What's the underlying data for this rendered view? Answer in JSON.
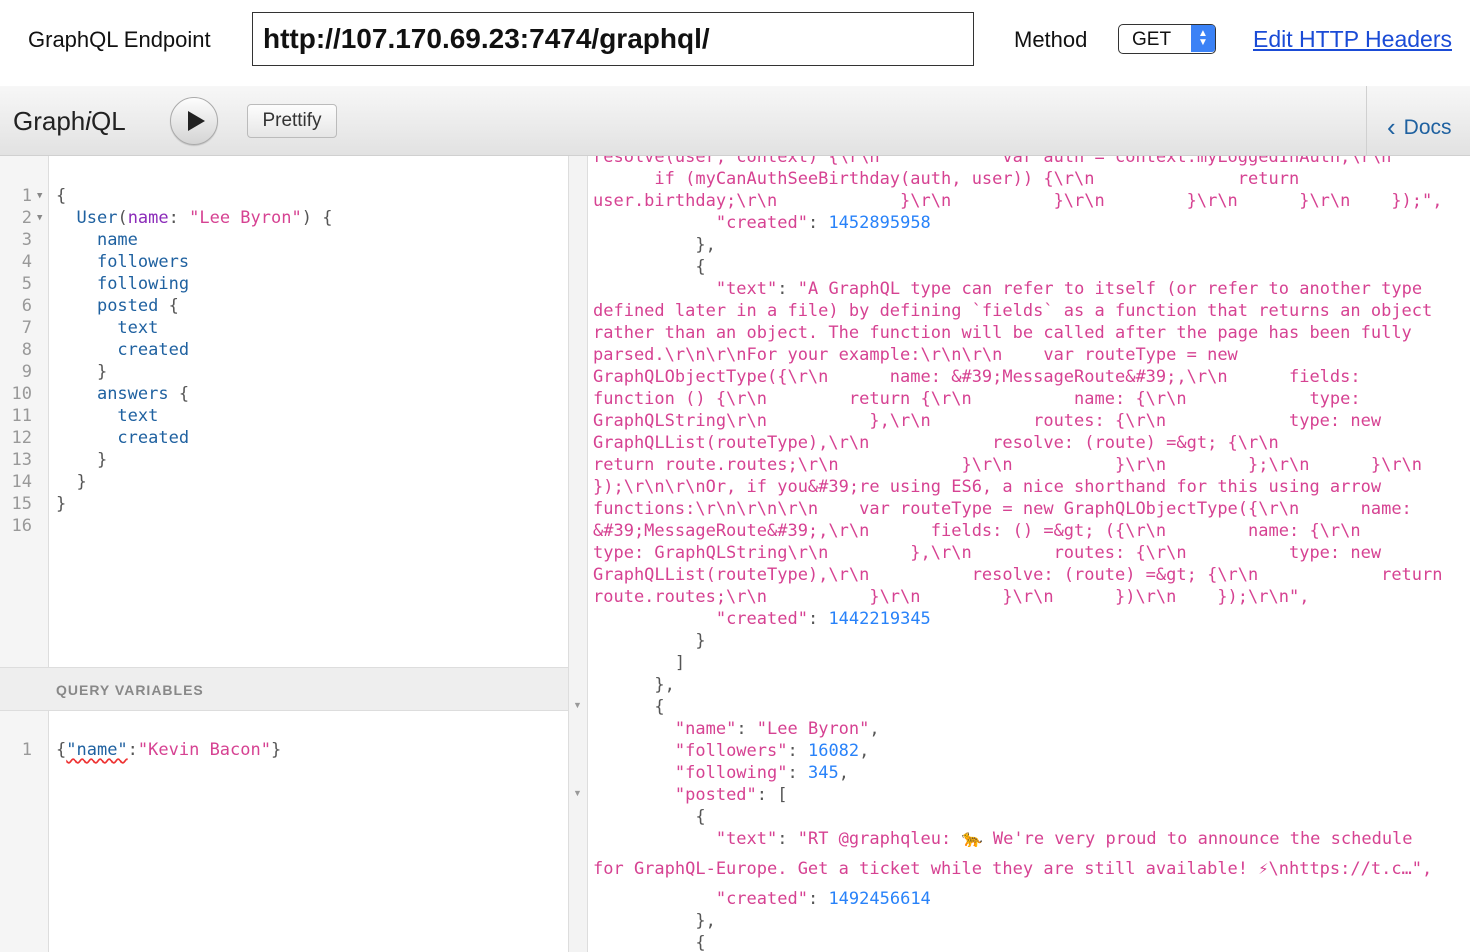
{
  "topbar": {
    "endpoint_label": "GraphQL Endpoint",
    "endpoint_url": "http://107.170.69.23:7474/graphql/",
    "method_label": "Method",
    "method_value": "GET",
    "headers_link": "Edit HTTP Headers"
  },
  "toolbar": {
    "logo_prefix": "Graph",
    "logo_italic": "i",
    "logo_suffix": "QL",
    "prettify_label": "Prettify",
    "docs_label": "Docs"
  },
  "query": {
    "line_numbers": [
      "1",
      "2",
      "3",
      "4",
      "5",
      "6",
      "7",
      "8",
      "9",
      "10",
      "11",
      "12",
      "13",
      "14",
      "15",
      "16"
    ],
    "l1": "{",
    "l2_field": "User",
    "l2_open": "(",
    "l2_arg": "name",
    "l2_colon": ": ",
    "l2_value": "\"Lee Byron\"",
    "l2_close": ") {",
    "l3": "name",
    "l4": "followers",
    "l5": "following",
    "l6_field": "posted",
    "l6_brace": " {",
    "l7": "text",
    "l8": "created",
    "l9": "}",
    "l10_field": "answers",
    "l10_brace": " {",
    "l11": "text",
    "l12": "created",
    "l13": "}",
    "l14": "}",
    "l15": "}"
  },
  "variables": {
    "title": "QUERY VARIABLES",
    "line_number": "1",
    "open": "{",
    "key": "\"name\"",
    "colon": ":",
    "value": "\"Kevin Bacon\"",
    "close": "}"
  },
  "result": {
    "lines": [
      {
        "type": "s",
        "text": "resolve(user, context) {\\r\\n            var auth = context.myLoggedInAuth;\\r\\n"
      },
      {
        "type": "s",
        "text": "      if (myCanAuthSeeBirthday(auth, user)) {\\r\\n              return"
      },
      {
        "type": "s",
        "text": "user.birthday;\\r\\n            }\\r\\n          }\\r\\n        }\\r\\n      }\\r\\n    });\","
      },
      {
        "type": "kv",
        "indent": "            ",
        "key": "\"created\"",
        "sep": ": ",
        "val": "1452895958",
        "valtype": "n",
        "tail": ""
      },
      {
        "type": "p",
        "text": "          },"
      },
      {
        "type": "p",
        "text": "          {"
      },
      {
        "type": "kv",
        "indent": "            ",
        "key": "\"text\"",
        "sep": ": ",
        "val": "\"A GraphQL type can refer to itself (or refer to another type",
        "valtype": "s",
        "tail": ""
      },
      {
        "type": "s",
        "text": "defined later in a file) by defining `fields` as a function that returns an object"
      },
      {
        "type": "s",
        "text": "rather than an object. The function will be called after the page has been fully"
      },
      {
        "type": "s",
        "text": "parsed.\\r\\n\\r\\nFor your example:\\r\\n\\r\\n    var routeType = new"
      },
      {
        "type": "s",
        "text": "GraphQLObjectType({\\r\\n      name: &#39;MessageRoute&#39;,\\r\\n      fields:"
      },
      {
        "type": "s",
        "text": "function () {\\r\\n        return {\\r\\n          name: {\\r\\n            type:"
      },
      {
        "type": "s",
        "text": "GraphQLString\\r\\n          },\\r\\n          routes: {\\r\\n            type: new"
      },
      {
        "type": "s",
        "text": "GraphQLList(routeType),\\r\\n            resolve: (route) =&gt; {\\r\\n"
      },
      {
        "type": "s",
        "text": "return route.routes;\\r\\n            }\\r\\n          }\\r\\n        };\\r\\n      }\\r\\n"
      },
      {
        "type": "s",
        "text": "});\\r\\n\\r\\nOr, if you&#39;re using ES6, a nice shorthand for this using arrow"
      },
      {
        "type": "s",
        "text": "functions:\\r\\n\\r\\n\\r\\n    var routeType = new GraphQLObjectType({\\r\\n      name:"
      },
      {
        "type": "s",
        "text": "&#39;MessageRoute&#39;,\\r\\n      fields: () =&gt; ({\\r\\n        name: {\\r\\n"
      },
      {
        "type": "s",
        "text": "type: GraphQLString\\r\\n        },\\r\\n        routes: {\\r\\n          type: new"
      },
      {
        "type": "s",
        "text": "GraphQLList(routeType),\\r\\n          resolve: (route) =&gt; {\\r\\n            return"
      },
      {
        "type": "s",
        "text": "route.routes;\\r\\n          }\\r\\n        }\\r\\n      })\\r\\n    });\\r\\n\","
      },
      {
        "type": "kv",
        "indent": "            ",
        "key": "\"created\"",
        "sep": ": ",
        "val": "1442219345",
        "valtype": "n",
        "tail": ""
      },
      {
        "type": "p",
        "text": "          }"
      },
      {
        "type": "p",
        "text": "        ]"
      },
      {
        "type": "p",
        "text": "      },"
      },
      {
        "type": "p",
        "text": "      {"
      },
      {
        "type": "kv",
        "indent": "        ",
        "key": "\"name\"",
        "sep": ": ",
        "val": "\"Lee Byron\"",
        "valtype": "s",
        "tail": ","
      },
      {
        "type": "kv",
        "indent": "        ",
        "key": "\"followers\"",
        "sep": ": ",
        "val": "16082",
        "valtype": "n",
        "tail": ","
      },
      {
        "type": "kv",
        "indent": "        ",
        "key": "\"following\"",
        "sep": ": ",
        "val": "345",
        "valtype": "n",
        "tail": ","
      },
      {
        "type": "kv",
        "indent": "        ",
        "key": "\"posted\"",
        "sep": ": ",
        "val": "[",
        "valtype": "p",
        "tail": ""
      },
      {
        "type": "p",
        "text": "          {"
      },
      {
        "type": "kv",
        "indent": "            ",
        "key": "\"text\"",
        "sep": ": ",
        "val": "\"RT @graphqleu: 🐆 We're very proud to announce the schedule",
        "valtype": "s",
        "tail": ""
      },
      {
        "type": "s",
        "text": "for GraphQL-Europe. Get a ticket while they are still available! ⚡\\nhttps://t.c…\","
      },
      {
        "type": "kv",
        "indent": "            ",
        "key": "\"created\"",
        "sep": ": ",
        "val": "1492456614",
        "valtype": "n",
        "tail": ""
      },
      {
        "type": "p",
        "text": "          },"
      },
      {
        "type": "p",
        "text": "          {"
      }
    ]
  }
}
